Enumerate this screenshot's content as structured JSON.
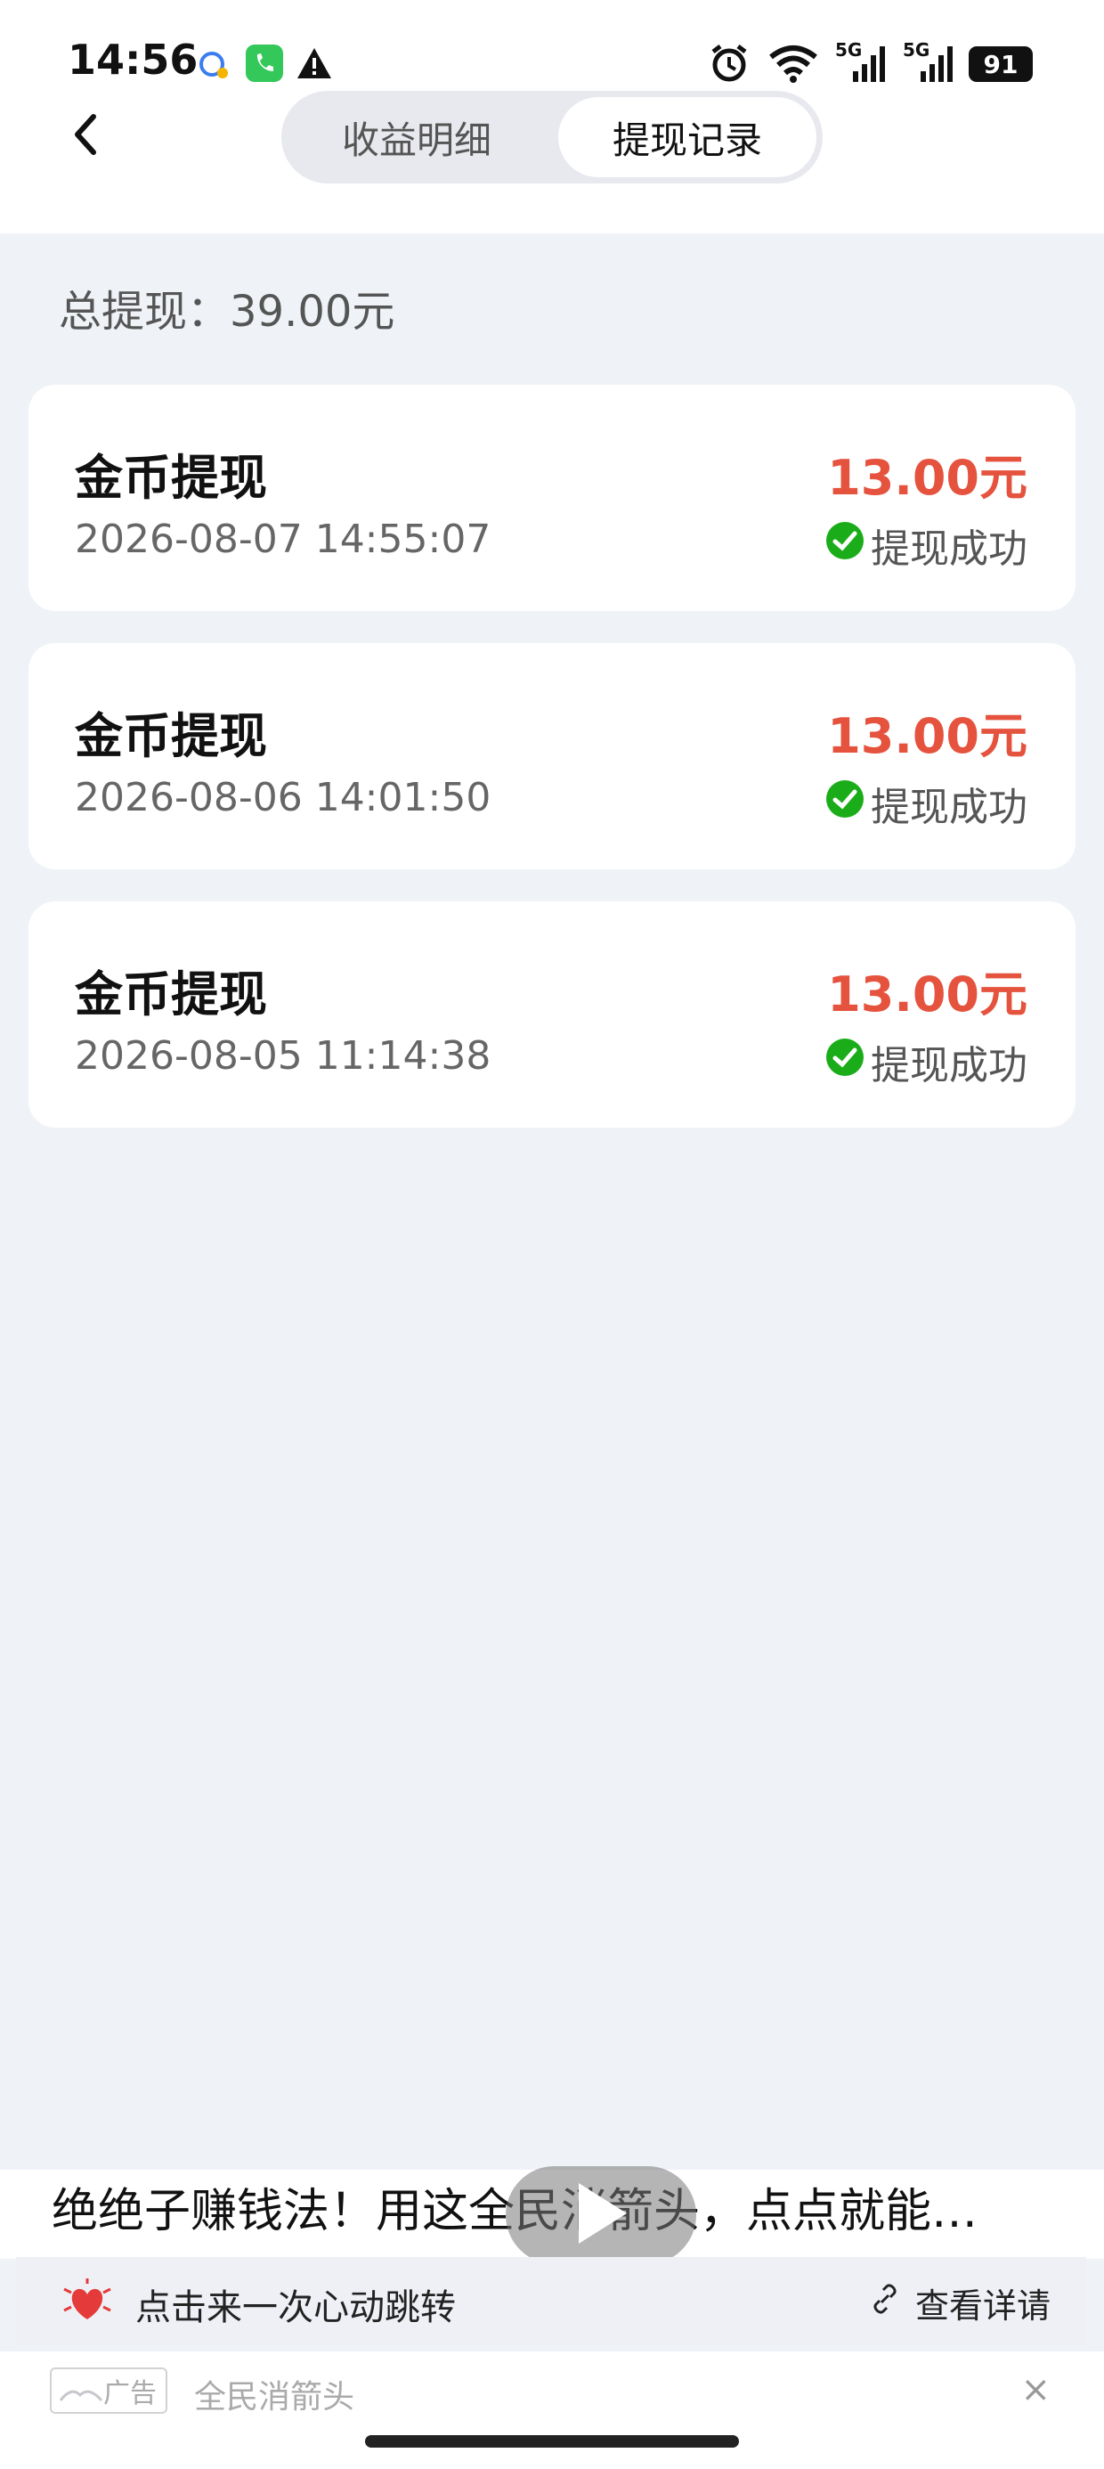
{
  "status_bar": {
    "time": "14:56",
    "battery": "91",
    "signal_labels": [
      "5G",
      "5G"
    ]
  },
  "tabs": [
    {
      "label": "收益明细",
      "active": false
    },
    {
      "label": "提现记录",
      "active": true
    }
  ],
  "summary": {
    "text": "总提现：39.00元"
  },
  "records": [
    {
      "title": "金币提现",
      "datetime": "2026-08-07 14:55:07",
      "amount": "13.00元",
      "status": "提现成功"
    },
    {
      "title": "金币提现",
      "datetime": "2026-08-06 14:01:50",
      "amount": "13.00元",
      "status": "提现成功"
    },
    {
      "title": "金币提现",
      "datetime": "2026-08-05 11:14:38",
      "amount": "13.00元",
      "status": "提现成功"
    }
  ],
  "ad": {
    "title": "绝绝子赚钱法！用这全民消箭头，点点就能…",
    "action_text": "点击来一次心动跳转",
    "detail_text": "查看详请",
    "badge_text": "广告",
    "source": "全民消箭头",
    "close_symbol": "×"
  },
  "colors": {
    "accent_amount": "#e5533e",
    "success_green": "#1aad19",
    "page_bg": "#eff2f7"
  }
}
